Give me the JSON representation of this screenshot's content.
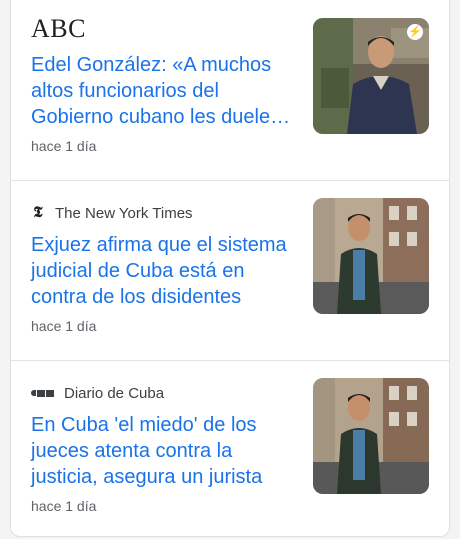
{
  "articles": [
    {
      "source": "ABC",
      "headline": "Edel González: «A muchos altos funcionarios del Gobierno cubano les duele…",
      "time": "hace 1 día",
      "amp_icon": "bolt"
    },
    {
      "source": "The New York Times",
      "headline": "Exjuez afirma que el sistema judicial de Cuba está en contra de los disidentes",
      "time": "hace 1 día"
    },
    {
      "source": "Diario de Cuba",
      "headline": "En Cuba 'el miedo' de los jueces atenta contra la justicia, asegura un jurista",
      "time": "hace 1 día"
    }
  ],
  "colors": {
    "headline": "#1a73e8",
    "meta": "#5f6368"
  }
}
